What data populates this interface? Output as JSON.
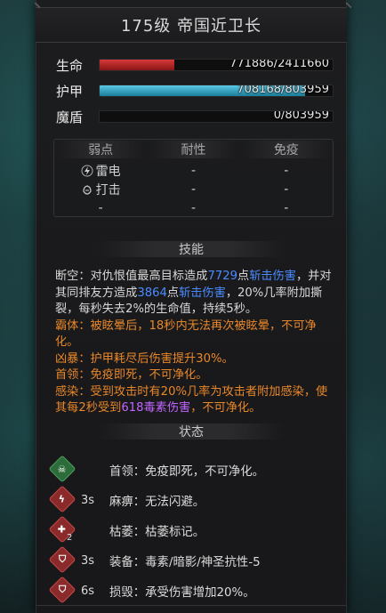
{
  "title": "175级  帝国近卫长",
  "stats": {
    "hp": {
      "label": "生命",
      "value_text": "771886/2411660",
      "current": 771886,
      "max": 2411660
    },
    "armor": {
      "label": "护甲",
      "value_text": "708168/803959",
      "current": 708168,
      "max": 803959
    },
    "shield": {
      "label": "魔盾",
      "value_text": "0/803959",
      "current": 0,
      "max": 803959
    }
  },
  "resistances": {
    "headers": [
      "弱点",
      "耐性",
      "免疫"
    ],
    "weakness": [
      {
        "icon": "lightning-icon",
        "label": "雷电"
      },
      {
        "icon": "fist-icon",
        "label": "打击"
      },
      {
        "icon": "",
        "label": "-"
      }
    ],
    "resistance": [
      "-",
      "-",
      "-"
    ],
    "immunity": [
      "-",
      "-",
      "-"
    ]
  },
  "skills_header": "技能",
  "skills": {
    "s1_a": "断空：对仇恨值最高目标造成",
    "s1_num1": "7729",
    "s1_b": "点",
    "s1_dmg1": "斩击伤害",
    "s1_c": "，并对其同排友方造成",
    "s1_num2": "3864",
    "s1_d": "点",
    "s1_dmg2": "斩击伤害",
    "s1_e": "，20%几率附加撕裂，每秒失去2%的生命值，持续5秒。",
    "s2": "霸体：被眩晕后，18秒内无法再次被眩晕，不可净化。",
    "s3": "凶暴：护甲耗尽后伤害提升30%。",
    "s4": "首领：免疫即死，不可净化。",
    "s5_a": "感染：受到攻击时有20%几率为攻击者附加感染，使其每2秒受到",
    "s5_num": "618",
    "s5_dmg": "毒素伤害",
    "s5_b": "，不可净化。"
  },
  "status_header": "状态",
  "statuses": [
    {
      "icon": "skull-icon",
      "time": "",
      "text": "首领：免疫即死，不可净化。",
      "stack": ""
    },
    {
      "icon": "numb-icon",
      "time": "3s",
      "text": "麻痹：无法闪避。",
      "stack": ""
    },
    {
      "icon": "wither-icon",
      "time": "",
      "text": "枯萎：枯萎标记。",
      "stack": "2"
    },
    {
      "icon": "shield-break-icon",
      "time": "3s",
      "text": "装备：毒素/暗影/神圣抗性-5",
      "stack": ""
    },
    {
      "icon": "shield-damage-icon",
      "time": "6s",
      "text": "损毁：承受伤害增加20%。",
      "stack": ""
    }
  ],
  "colors": {
    "hp": "#c42a2a",
    "armor": "#3fb0d0",
    "damage_blue": "#4a8cff",
    "damage_purple": "#c165ff",
    "passive_orange": "#e8872a"
  }
}
